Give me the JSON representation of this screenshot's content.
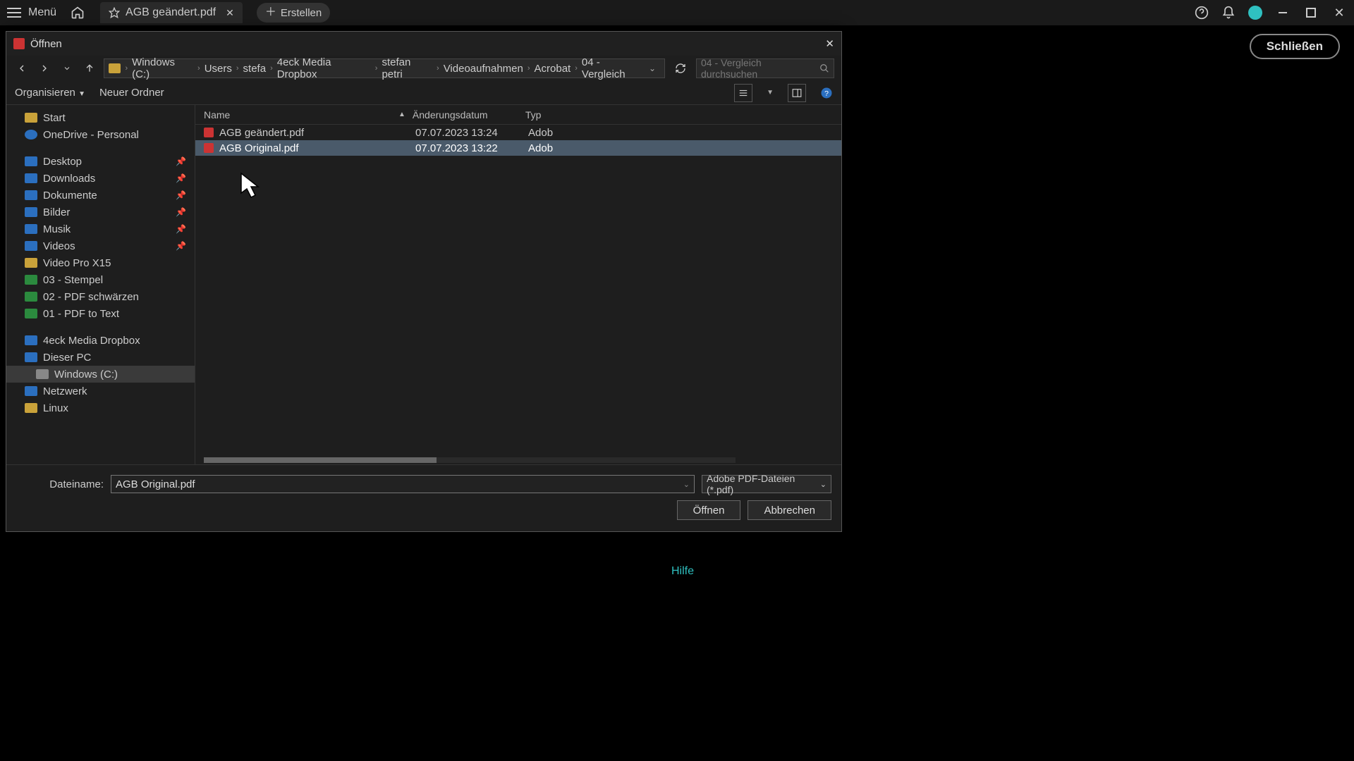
{
  "titlebar": {
    "menu": "Menü",
    "tab_title": "AGB geändert.pdf",
    "create": "Erstellen"
  },
  "schliessen": "Schließen",
  "dialog": {
    "title": "Öffnen",
    "breadcrumb": [
      "Windows (C:)",
      "Users",
      "stefa",
      "4eck Media Dropbox",
      "stefan petri",
      "Videoaufnahmen",
      "Acrobat",
      "04 - Vergleich"
    ],
    "search_placeholder": "04 - Vergleich durchsuchen",
    "organize": "Organisieren",
    "new_folder": "Neuer Ordner",
    "cols": {
      "name": "Name",
      "date": "Änderungsdatum",
      "type": "Typ"
    },
    "files": [
      {
        "name": "AGB geändert.pdf",
        "date": "07.07.2023 13:24",
        "type": "Adob",
        "selected": false
      },
      {
        "name": "AGB Original.pdf",
        "date": "07.07.2023 13:22",
        "type": "Adob",
        "selected": true
      }
    ],
    "sidebar": {
      "start": "Start",
      "onedrive": "OneDrive - Personal",
      "quick": [
        "Desktop",
        "Downloads",
        "Dokumente",
        "Bilder",
        "Musik",
        "Videos",
        "Video Pro X15",
        "03 - Stempel",
        "02 - PDF schwärzen",
        "01 - PDF to Text"
      ],
      "dropbox": "4eck Media Dropbox",
      "this_pc": "Dieser PC",
      "windows_c": "Windows (C:)",
      "network": "Netzwerk",
      "linux": "Linux"
    },
    "filename_label": "Dateiname:",
    "filename_value": "AGB Original.pdf",
    "filetype": "Adobe PDF-Dateien (*.pdf)",
    "open_btn": "Öffnen",
    "cancel_btn": "Abbrechen"
  },
  "hilfe": "Hilfe"
}
